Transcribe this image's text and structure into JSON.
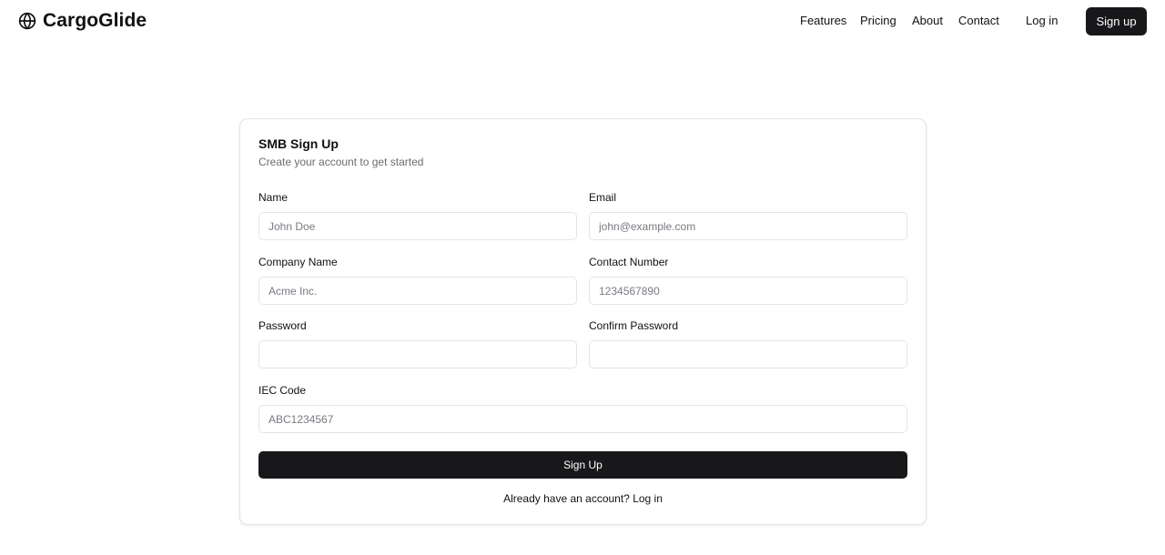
{
  "header": {
    "brand": "CargoGlide",
    "nav": [
      "Features",
      "Pricing",
      "About",
      "Contact"
    ],
    "login_label": "Log in",
    "signup_label": "Sign up"
  },
  "form": {
    "title": "SMB Sign Up",
    "subtitle": "Create your account to get started",
    "fields": {
      "name": {
        "label": "Name",
        "placeholder": "John Doe",
        "value": ""
      },
      "email": {
        "label": "Email",
        "placeholder": "john@example.com",
        "value": ""
      },
      "company": {
        "label": "Company Name",
        "placeholder": "Acme Inc.",
        "value": ""
      },
      "contact": {
        "label": "Contact Number",
        "placeholder": "1234567890",
        "value": ""
      },
      "password": {
        "label": "Password",
        "placeholder": "",
        "value": ""
      },
      "confirm": {
        "label": "Confirm Password",
        "placeholder": "",
        "value": ""
      },
      "iec": {
        "label": "IEC Code",
        "placeholder": "ABC1234567",
        "value": ""
      }
    },
    "submit_label": "Sign Up",
    "footer_prefix": "Already have an account?",
    "footer_link": "Log in"
  },
  "colors": {
    "primary": "#18181b",
    "border": "#e4e4e7",
    "muted_text": "#6b6b72"
  },
  "icons": {
    "brand": "globe-icon"
  }
}
